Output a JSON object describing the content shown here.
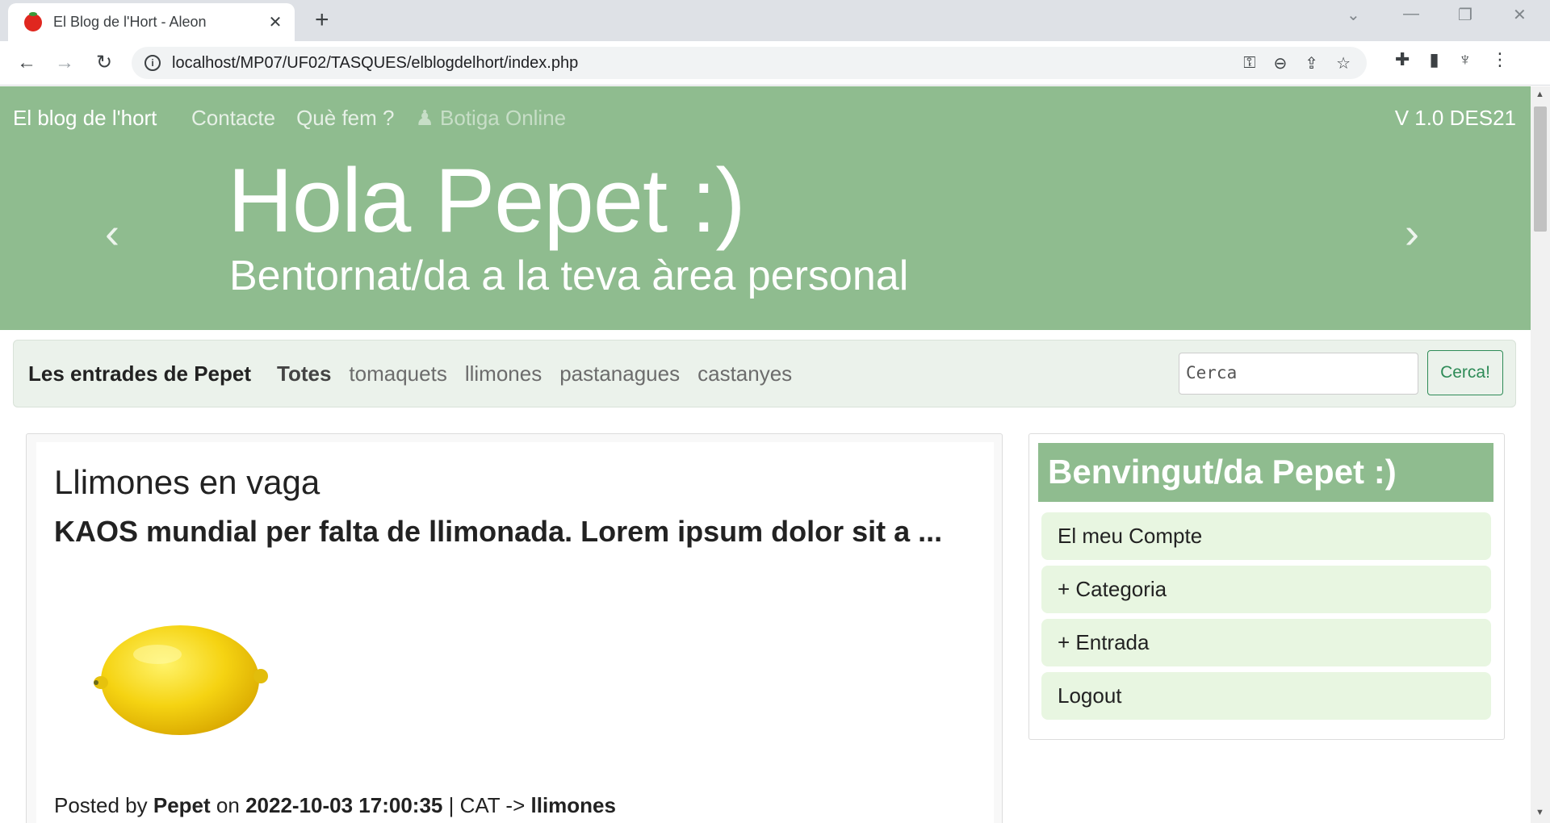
{
  "browser": {
    "tab_title": "El Blog de l'Hort - Aleon",
    "url": "localhost/MP07/UF02/TASQUES/elblogdelhort/index.php"
  },
  "nav": {
    "brand": "El blog de l'hort",
    "links": [
      "Contacte",
      "Què fem ?",
      "Botiga Online"
    ],
    "version": "V 1.0 DES21"
  },
  "hero": {
    "title": "Hola Pepet :)",
    "subtitle": "Bentornat/da a la teva àrea personal"
  },
  "categories": {
    "heading": "Les entrades de Pepet",
    "items": [
      "Totes",
      "tomaquets",
      "llimones",
      "pastanagues",
      "castanyes"
    ],
    "search_placeholder": "Cerca",
    "search_button": "Cerca!"
  },
  "post": {
    "title": "Llimones en vaga",
    "summary": "KAOS mundial per falta de llimonada. Lorem ipsum dolor sit a ...",
    "meta_posted_by": "Posted by",
    "author": "Pepet",
    "meta_on": "on",
    "date": "2022-10-03 17:00:35",
    "meta_cat": "| CAT ->",
    "category": "llimones"
  },
  "sidebar": {
    "heading": "Benvingut/da Pepet :)",
    "items": [
      "El meu Compte",
      "+ Categoria",
      "+ Entrada",
      "Logout"
    ]
  },
  "colors": {
    "brand_green": "#8fbc8f",
    "button_green": "#2e8b57",
    "menu_item_bg": "#e8f6e1"
  }
}
